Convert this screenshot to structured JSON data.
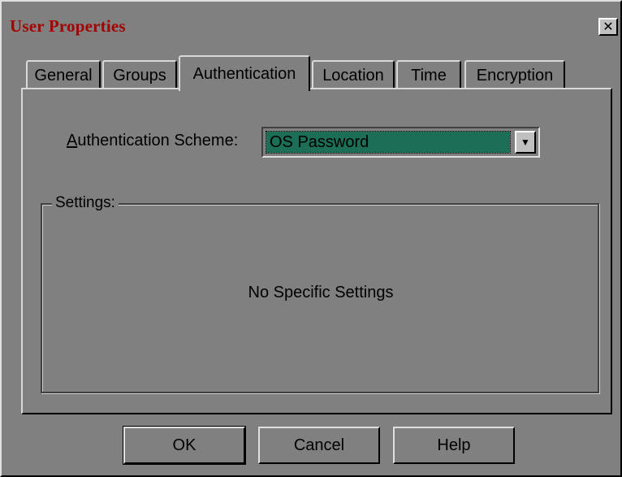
{
  "window": {
    "title": "User Properties",
    "close_label": "✕"
  },
  "tabs": [
    {
      "label": "General",
      "active": false
    },
    {
      "label": "Groups",
      "active": false
    },
    {
      "label": "Authentication",
      "active": true
    },
    {
      "label": "Location",
      "active": false
    },
    {
      "label": "Time",
      "active": false
    },
    {
      "label": "Encryption",
      "active": false
    }
  ],
  "authentication": {
    "scheme_label_accel": "A",
    "scheme_label_rest": "uthentication Scheme:",
    "scheme_value": "OS Password",
    "dropdown_arrow": "▼"
  },
  "settings": {
    "legend": "Settings:",
    "message": "No Specific Settings"
  },
  "buttons": {
    "ok": "OK",
    "cancel": "Cancel",
    "help": "Help"
  },
  "colors": {
    "title_text": "#a40000",
    "dialog_background": "#808080",
    "selected_value_background": "#1d6e56"
  }
}
